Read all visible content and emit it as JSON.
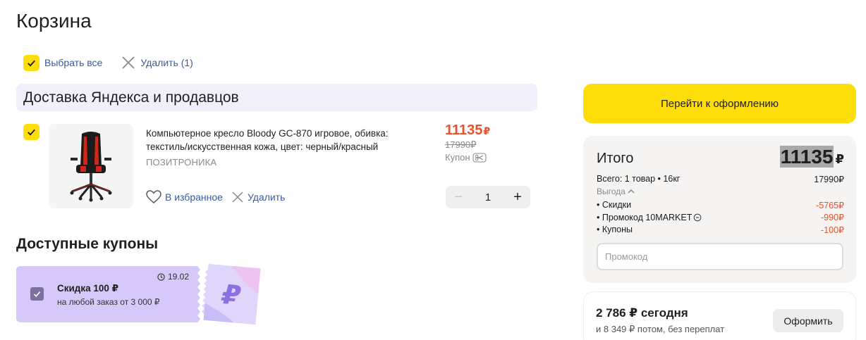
{
  "page": {
    "title": "Корзина"
  },
  "toolbar": {
    "select_all_label": "Выбрать все",
    "delete_label": "Удалить (1)"
  },
  "group": {
    "title": "Доставка Яндекса и продавцов"
  },
  "item": {
    "name": "Компьютерное кресло Bloody GC-870 игровое, обивка: текстиль/искусственная кожа, цвет: черный/красный",
    "seller": "ПОЗИТРОНИКА",
    "favorite_label": "В избранное",
    "remove_label": "Удалить",
    "price": "11135",
    "currency": "₽",
    "old_price": "17990₽",
    "coupon_label": "Купон",
    "quantity": "1",
    "minus": "−",
    "plus": "+"
  },
  "coupons": {
    "title": "Доступные купоны",
    "items": [
      {
        "date": "19.02",
        "title": "Скидка 100 ₽",
        "subtitle": "на любой заказ от 3 000 ₽",
        "promo_glyph": "₽"
      }
    ]
  },
  "checkout": {
    "button_label": "Перейти к оформлению"
  },
  "summary": {
    "title": "Итого",
    "total": "11135",
    "currency": "₽",
    "items_label": "Всего: 1 товар • 16кг",
    "items_value": "17990₽",
    "benefit_label": "Выгода",
    "rows": [
      {
        "label": "• Скидки",
        "value": "-5765₽"
      },
      {
        "label": "• Промокод 10MARKET",
        "value": "-990₽"
      },
      {
        "label": "• Купоны",
        "value": "-100₽"
      }
    ],
    "promo_placeholder": "Промокод"
  },
  "split": {
    "today": "2 786 ₽ сегодня",
    "later": "и 8 349 ₽ потом, без переплат",
    "button_label": "Оформить"
  },
  "colors": {
    "accent_yellow": "#fddd0a",
    "price_red": "#e8512b",
    "link_blue": "#3a5a9e",
    "coupon_purple": "#d6c8f9"
  }
}
